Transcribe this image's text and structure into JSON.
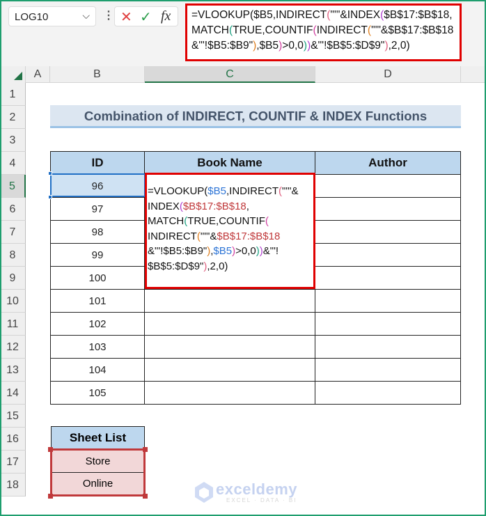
{
  "name_box": "LOG10",
  "formula_bar_icons": {
    "cancel": "✕",
    "enter": "✓",
    "fx": "fx"
  },
  "formula_bar": [
    [
      {
        "t": "=VLOOKUP($B5,INDIRECT",
        "c": "#111"
      },
      {
        "t": "(",
        "c": "#e06080"
      },
      {
        "t": "\"'\"&INDEX",
        "c": "#111"
      },
      {
        "t": "(",
        "c": "#b040d0"
      },
      {
        "t": "$B$17:$B$18,",
        "c": "#111"
      }
    ],
    [
      {
        "t": "MATCH",
        "c": "#111"
      },
      {
        "t": "(",
        "c": "#1aa080"
      },
      {
        "t": "TRUE,COUNTIF",
        "c": "#111"
      },
      {
        "t": "(",
        "c": "#d040a0"
      },
      {
        "t": "INDIRECT",
        "c": "#111"
      },
      {
        "t": "(",
        "c": "#e08020"
      },
      {
        "t": "\"'\"&$B$17:$B$18",
        "c": "#111"
      }
    ],
    [
      {
        "t": "&\"'!$B5:$B9\"",
        "c": "#111"
      },
      {
        "t": ")",
        "c": "#e08020"
      },
      {
        "t": ",$B5",
        "c": "#111"
      },
      {
        "t": ")",
        "c": "#d040a0"
      },
      {
        "t": ">0,0",
        "c": "#111"
      },
      {
        "t": ")",
        "c": "#1aa080"
      },
      {
        "t": ")",
        "c": "#b040d0"
      },
      {
        "t": "&\"'!$B$5:$D$9\"",
        "c": "#111"
      },
      {
        "t": ")",
        "c": "#e06080"
      },
      {
        "t": ",2,0)",
        "c": "#111"
      }
    ]
  ],
  "columns": [
    "A",
    "B",
    "C",
    "D"
  ],
  "rows": [
    "1",
    "2",
    "3",
    "4",
    "5",
    "6",
    "7",
    "8",
    "9",
    "10",
    "11",
    "12",
    "13",
    "14",
    "15",
    "16",
    "17",
    "18"
  ],
  "title": "Combination of INDIRECT, COUNTIF & INDEX Functions",
  "table": {
    "headers": [
      "ID",
      "Book Name",
      "Author"
    ],
    "ids": [
      "96",
      "97",
      "98",
      "99",
      "100",
      "101",
      "102",
      "103",
      "104",
      "105"
    ]
  },
  "cell_formula": [
    [
      {
        "t": "=VLOOKUP(",
        "c": "#111"
      },
      {
        "t": "$B5",
        "c": "#2e75d6"
      },
      {
        "t": ",INDIRECT",
        "c": "#111"
      },
      {
        "t": "(",
        "c": "#e06080"
      },
      {
        "t": "\"'\"&",
        "c": "#111"
      }
    ],
    [
      {
        "t": "INDEX",
        "c": "#111"
      },
      {
        "t": "(",
        "c": "#b040d0"
      },
      {
        "t": "$B$17:$B$18",
        "c": "#c0393b"
      },
      {
        "t": ",",
        "c": "#111"
      }
    ],
    [
      {
        "t": "MATCH",
        "c": "#111"
      },
      {
        "t": "(",
        "c": "#1aa080"
      },
      {
        "t": "TRUE,COUNTIF",
        "c": "#111"
      },
      {
        "t": "(",
        "c": "#d040a0"
      }
    ],
    [
      {
        "t": "INDIRECT",
        "c": "#111"
      },
      {
        "t": "(",
        "c": "#e08020"
      },
      {
        "t": "\"'\"&",
        "c": "#111"
      },
      {
        "t": "$B$17:$B$18",
        "c": "#c0393b"
      }
    ],
    [
      {
        "t": "&\"'!$B5:$B9\"",
        "c": "#111"
      },
      {
        "t": ")",
        "c": "#e08020"
      },
      {
        "t": ",",
        "c": "#111"
      },
      {
        "t": "$B5",
        "c": "#2e75d6"
      },
      {
        "t": ")",
        "c": "#d040a0"
      },
      {
        "t": ">0,0",
        "c": "#111"
      },
      {
        "t": ")",
        "c": "#1aa080"
      },
      {
        "t": ")",
        "c": "#b040d0"
      },
      {
        "t": "&\"'!",
        "c": "#111"
      }
    ],
    [
      {
        "t": "$B$5:$D$9\"",
        "c": "#111"
      },
      {
        "t": ")",
        "c": "#e06080"
      },
      {
        "t": ",2,0)",
        "c": "#111"
      }
    ]
  ],
  "sheet_list": {
    "header": "Sheet List",
    "items": [
      "Store",
      "Online"
    ]
  },
  "watermark": {
    "name": "exceldemy",
    "tagline": "EXCEL · DATA · BI"
  }
}
